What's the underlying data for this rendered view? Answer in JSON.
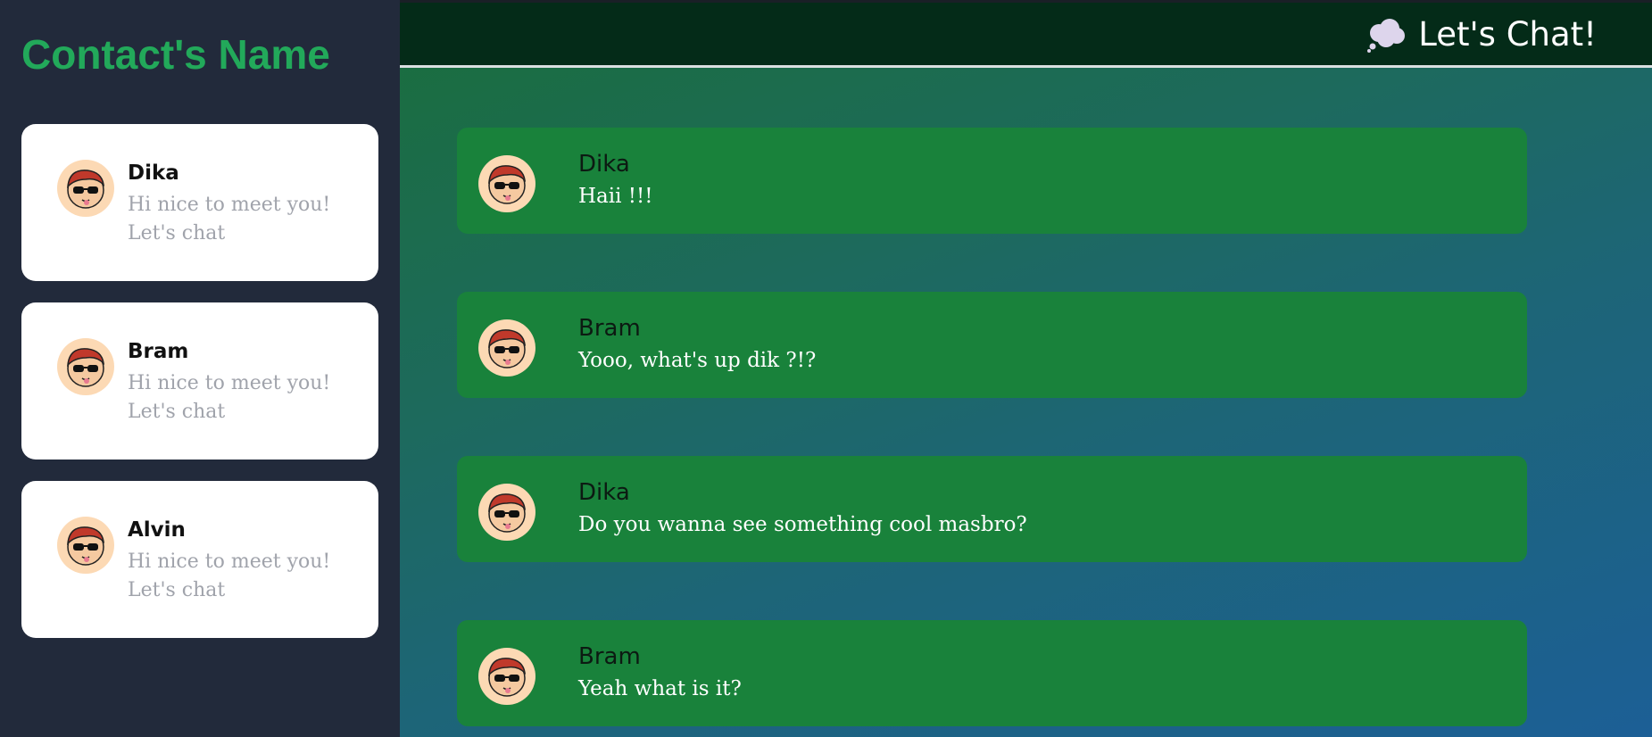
{
  "sidebar": {
    "title": "Contact's Name",
    "contacts": [
      {
        "name": "Dika",
        "preview": "Hi nice to meet you! Let's chat"
      },
      {
        "name": "Bram",
        "preview": "Hi nice to meet you! Let's chat"
      },
      {
        "name": "Alvin",
        "preview": "Hi nice to meet you! Let's chat"
      }
    ]
  },
  "header": {
    "icon": "thought-cloud-icon",
    "title": "Let's Chat!"
  },
  "messages": [
    {
      "sender": "Dika",
      "text": "Haii !!!"
    },
    {
      "sender": "Bram",
      "text": "Yooo, what's up dik ?!?"
    },
    {
      "sender": "Dika",
      "text": "Do you wanna see something cool masbro?"
    },
    {
      "sender": "Bram",
      "text": "Yeah what is it?"
    }
  ],
  "colors": {
    "sidebar_bg": "#222a3b",
    "accent_green": "#22a95a",
    "message_bg": "#19823b",
    "topbar_bg": "#042b18"
  }
}
